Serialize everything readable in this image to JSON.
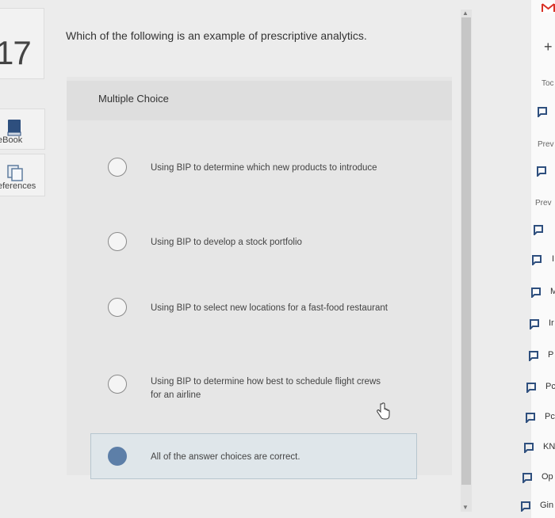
{
  "question": {
    "number": "17",
    "prompt": "Which of the following is an example of prescriptive analytics."
  },
  "side_tools": [
    {
      "label": "eBook",
      "icon": "book-icon"
    },
    {
      "label": "eferences",
      "icon": "references-icon"
    }
  ],
  "choices_header": "Multiple Choice",
  "choices": [
    {
      "text": "Using BIP to determine which new products to introduce",
      "selected": false
    },
    {
      "text": "Using BIP to develop a stock portfolio",
      "selected": false
    },
    {
      "text": "Using BIP to select new locations for a fast-food restaurant",
      "selected": false
    },
    {
      "text": "Using BIP to determine how best to schedule flight crews for an airline",
      "selected": false
    },
    {
      "text": "All of the answer choices are correct.",
      "selected": true
    }
  ],
  "right_panel": {
    "top_icon": "gmail-icon",
    "plus_label": "+",
    "labels": [
      "Toc",
      "Prev",
      "Prev"
    ],
    "bookmarks": [
      "",
      "",
      "",
      "",
      "I",
      "M",
      "Ir",
      "P",
      "Pc",
      "Pc",
      "KN",
      "Op",
      "Gin"
    ]
  },
  "colors": {
    "selected_radio": "#5d7fa8",
    "selected_bg": "#dfe6ea"
  }
}
